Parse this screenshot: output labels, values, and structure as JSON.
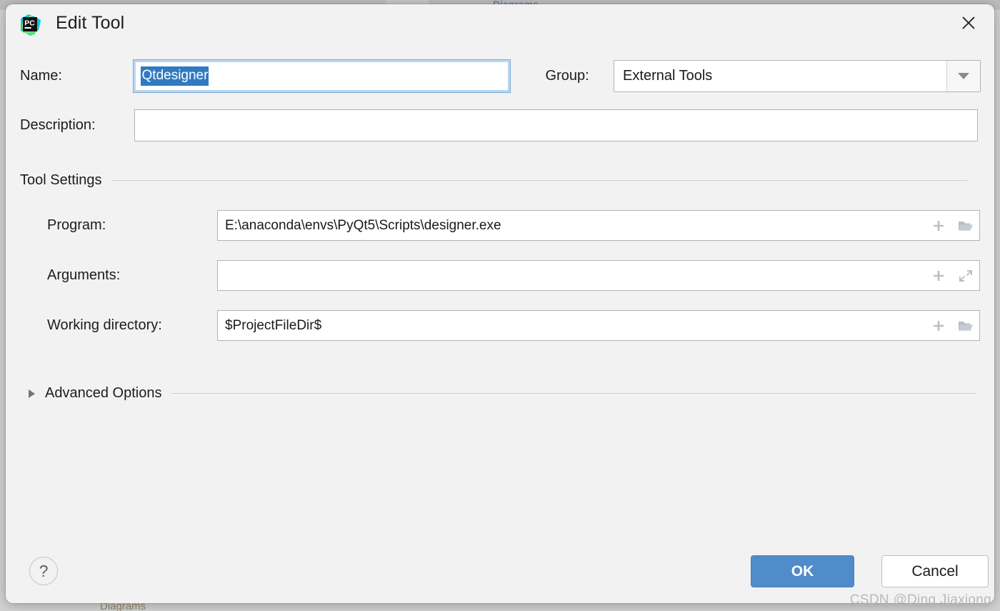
{
  "background": {
    "ghost_menu_text": "Diagrams",
    "ghost_tab_text": "Diagrams"
  },
  "dialog": {
    "title": "Edit Tool",
    "logo_icon": "pycharm-logo-icon",
    "close_icon": "close-icon"
  },
  "form": {
    "name_label": "Name:",
    "name_value": "Qtdesigner",
    "group_label": "Group:",
    "group_value": "External Tools",
    "group_dropdown_icon": "chevron-down-icon",
    "description_label": "Description:",
    "description_value": "",
    "description_placeholder": ""
  },
  "tool_settings": {
    "section_title": "Tool Settings",
    "program_label": "Program:",
    "program_value": "E:\\anaconda\\envs\\PyQt5\\Scripts\\designer.exe",
    "program_insert_icon": "plus-icon",
    "program_browse_icon": "folder-icon",
    "arguments_label": "Arguments:",
    "arguments_value": "",
    "arguments_insert_icon": "plus-icon",
    "arguments_expand_icon": "expand-diagonal-icon",
    "working_dir_label": "Working directory:",
    "working_dir_value": "$ProjectFileDir$",
    "working_dir_insert_icon": "plus-icon",
    "working_dir_browse_icon": "folder-icon"
  },
  "advanced": {
    "label": "Advanced Options",
    "expanded": false,
    "toggle_icon": "triangle-right-icon"
  },
  "footer": {
    "help_label": "?",
    "ok_label": "OK",
    "cancel_label": "Cancel"
  },
  "watermark": {
    "text": "CSDN @Ding Jiaxiong"
  },
  "colors": {
    "dialog_bg": "#f2f2f2",
    "accent_blue": "#4f8cc9",
    "selection_blue": "#2f7ac1",
    "focus_ring": "#bcd7ef",
    "field_border": "#b3b3b3",
    "icon_gray": "#b8bfc6"
  }
}
